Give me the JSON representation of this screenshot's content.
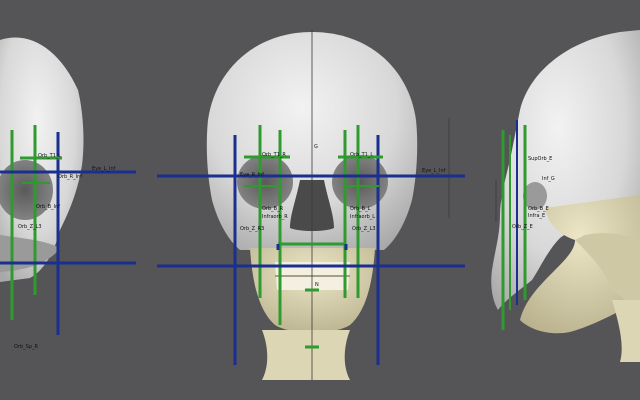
{
  "colors": {
    "background": "#555557",
    "bone": "#e4e4e4",
    "mandible": "#ddd6b4",
    "guide_green": "#2f9a2f",
    "guide_blue": "#1b2f8e"
  },
  "left_view": {
    "labels": [
      "Orb_T1_L",
      "Orb_R_Inf",
      "Eye_L_Inf",
      "Orb_B_Inf",
      "Orb_Z_L3",
      "Orb_Sp_R"
    ]
  },
  "center_view": {
    "labels": [
      "G",
      "Orb_T1_R",
      "Orb_T1_L",
      "Eye_R_Inf",
      "Eye_L_Inf",
      "Orb_B_R",
      "Orb_B_L",
      "Infraorb_R",
      "Infraorb_L",
      "Orb_Z_R3",
      "Orb_Z_L3",
      "N"
    ]
  },
  "right_view": {
    "labels": [
      "SupOrb_E",
      "Inf_G",
      "Orb_B_E",
      "Infra_E",
      "Orb_Z_E"
    ]
  }
}
